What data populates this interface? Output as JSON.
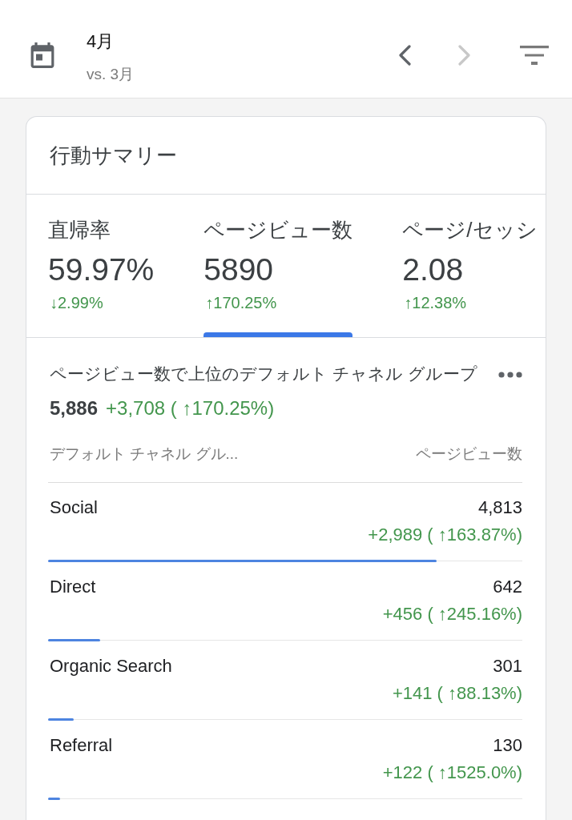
{
  "header": {
    "title": "4月",
    "comparison": "vs. 3月",
    "previous_button": {
      "disabled": false
    },
    "next_button": {
      "disabled": true
    }
  },
  "card": {
    "title": "行動サマリー",
    "metrics": [
      {
        "label": "直帰率",
        "value": "59.97%",
        "change": "↓2.99%",
        "selected": false
      },
      {
        "label": "ページビュー数",
        "value": "5890",
        "change": "↑170.25%",
        "selected": true
      },
      {
        "label": "ページ/セッシ",
        "value": "2.08",
        "change": "↑12.38%",
        "selected": false
      }
    ],
    "breakdown": {
      "title": "ページビュー数で上位のデフォルト チャネル グループ",
      "total": "5,886",
      "total_change": "+3,708 ( ↑170.25%)",
      "columns": [
        "デフォルト チャネル グル...",
        "ページビュー数"
      ],
      "rows": [
        {
          "name": "Social",
          "value": "4,813",
          "change": "+2,989 ( ↑163.87%)",
          "level": 0.82
        },
        {
          "name": "Direct",
          "value": "642",
          "change": "+456 ( ↑245.16%)",
          "level": 0.11
        },
        {
          "name": "Organic Search",
          "value": "301",
          "change": "+141 ( ↑88.13%)",
          "level": 0.054
        },
        {
          "name": "Referral",
          "value": "130",
          "change": "+122 ( ↑1525.0%)",
          "level": 0.025
        }
      ]
    }
  }
}
